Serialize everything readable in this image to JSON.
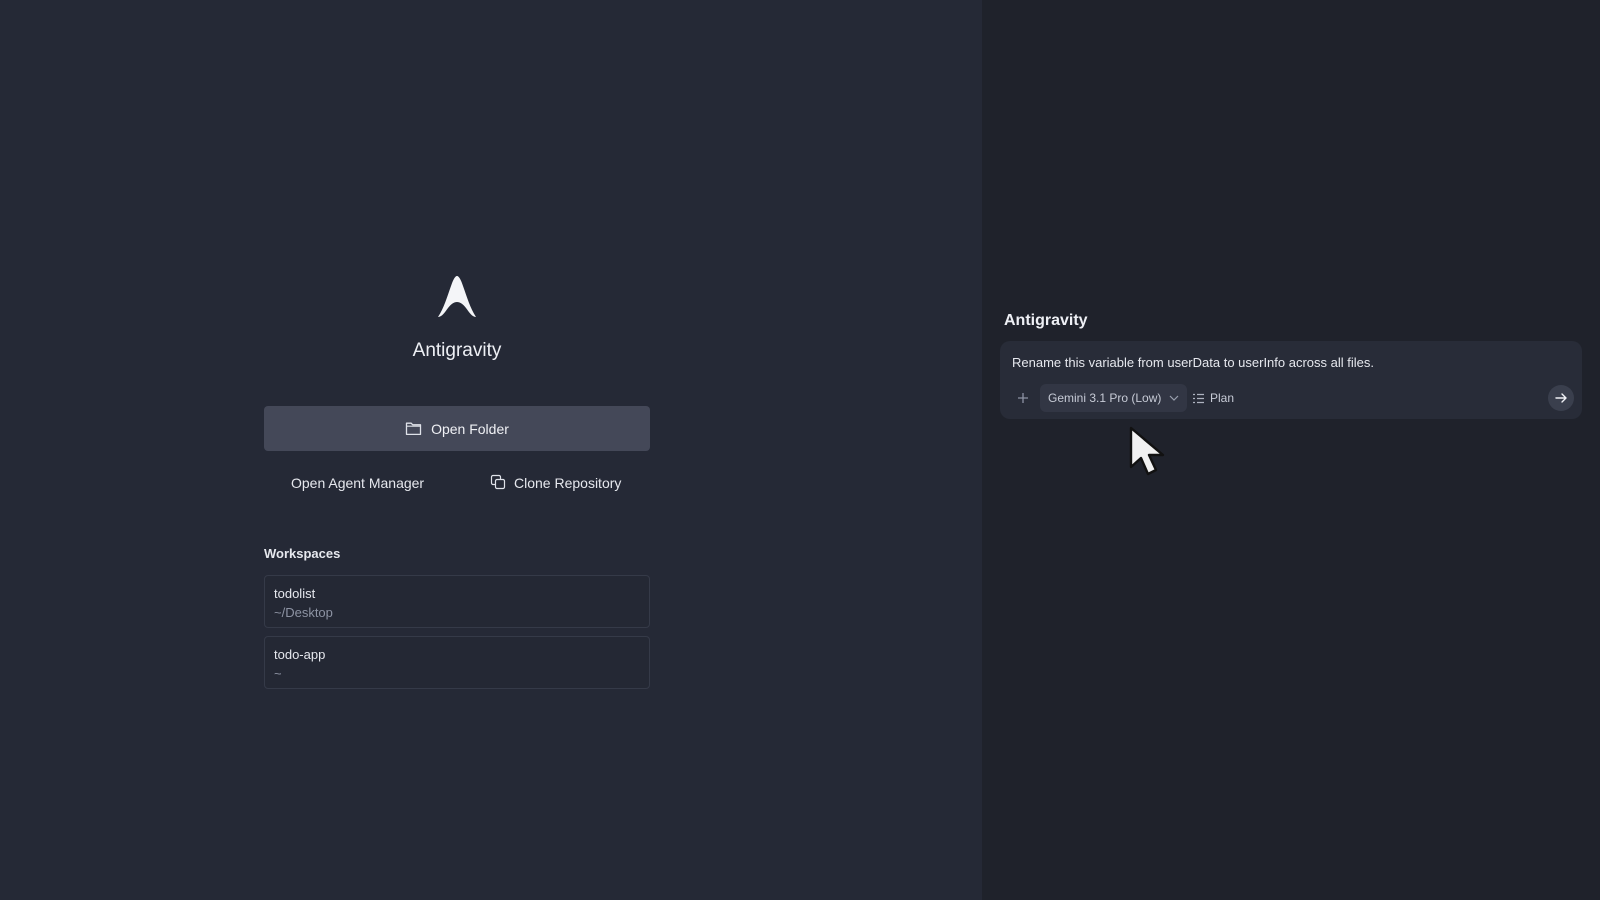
{
  "welcome": {
    "app_name": "Antigravity",
    "open_folder_label": "Open Folder",
    "open_agent_manager_label": "Open Agent Manager",
    "clone_repository_label": "Clone Repository",
    "workspaces_title": "Workspaces",
    "workspaces": [
      {
        "name": "todolist",
        "path": "~/Desktop"
      },
      {
        "name": "todo-app",
        "path": "~"
      }
    ]
  },
  "agent_panel": {
    "title": "Antigravity",
    "prompt": "Rename this variable from userData to userInfo across all files.",
    "model": "Gemini 3.1 Pro (Low)",
    "mode": "Plan"
  },
  "icons": {
    "logo": "antigravity-logo",
    "open_folder": "folder-icon",
    "clone": "copy-icon",
    "add": "plus-icon",
    "model_dropdown": "chevron-down-icon",
    "plan": "list-icon",
    "send": "arrow-right-icon",
    "mouse": "mouse-pointer-icon"
  },
  "colors": {
    "left_background": "#252936",
    "right_background": "#1f222b",
    "primary_button": "#444858"
  }
}
